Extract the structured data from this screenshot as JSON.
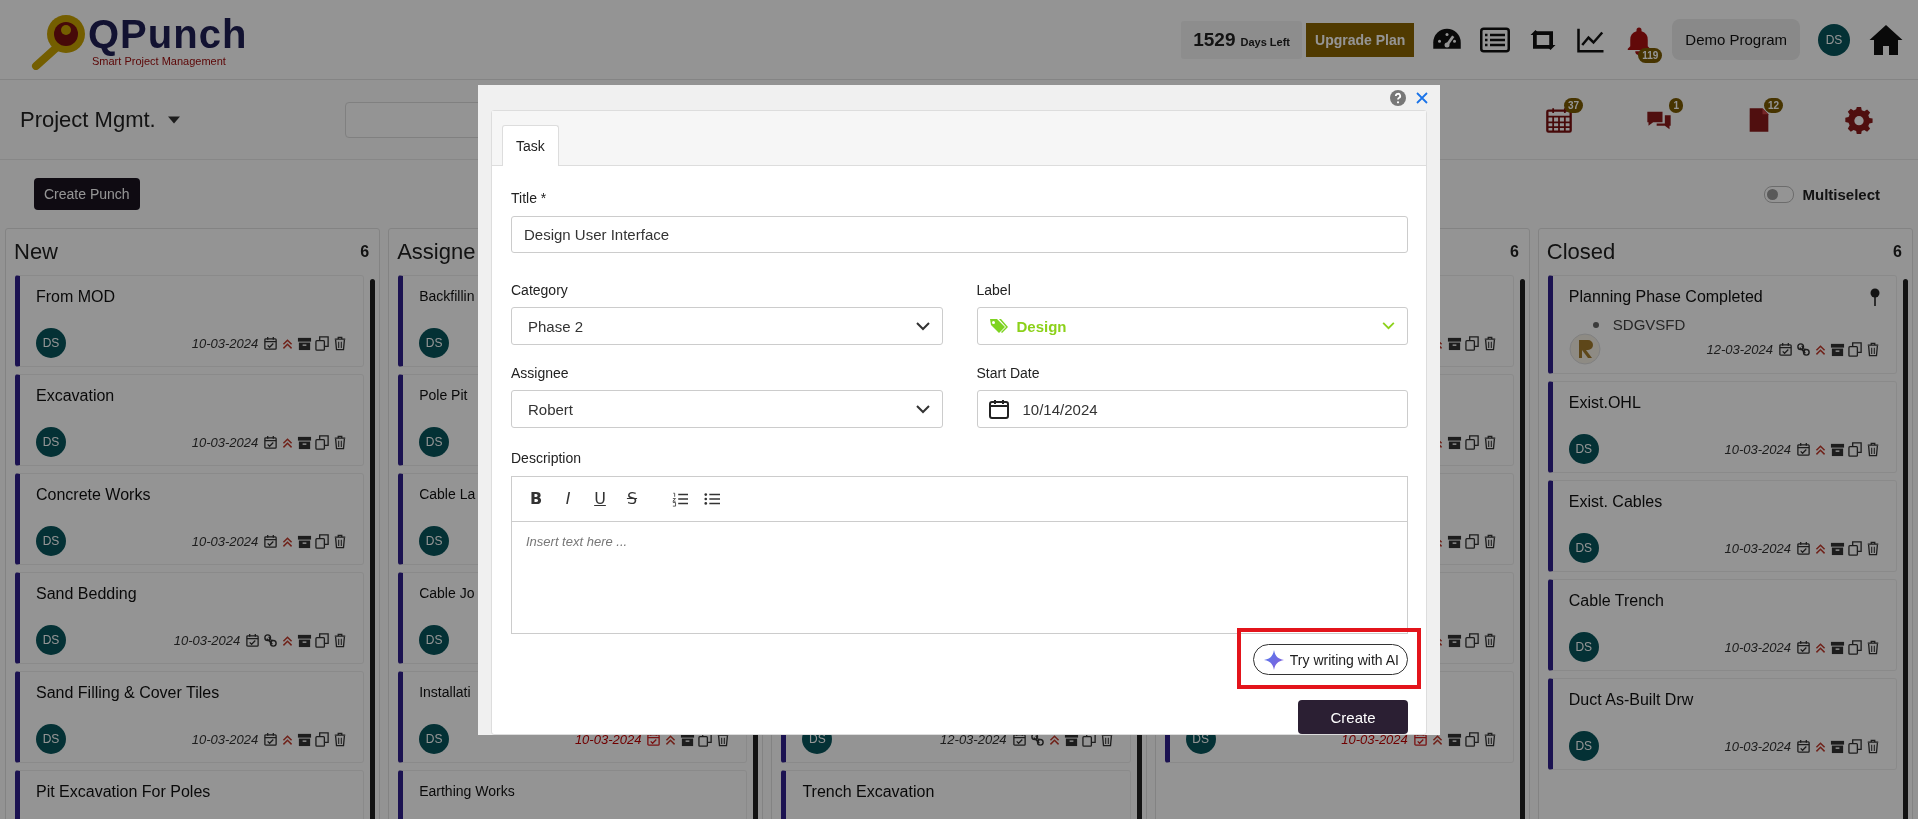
{
  "header": {
    "logo": {
      "name": "QPunch",
      "tagline": "Smart Project Management"
    },
    "days_left": {
      "count": "1529",
      "label": "Days Left"
    },
    "upgrade_button": "Upgrade Plan",
    "toolbar_icons": [
      {
        "kind": "dashboard"
      },
      {
        "kind": "list"
      },
      {
        "kind": "sync"
      },
      {
        "kind": "chart"
      },
      {
        "kind": "bell",
        "badge": "119"
      }
    ],
    "program": "Demo Program",
    "user_avatar": "DS"
  },
  "subbar": {
    "title": "Project Mgmt.",
    "icons": [
      {
        "kind": "calendar",
        "badge": "37"
      },
      {
        "kind": "chat",
        "badge": "1"
      },
      {
        "kind": "document",
        "badge": "12"
      },
      {
        "kind": "gear"
      }
    ]
  },
  "actions": {
    "create_button": "Create Punch",
    "multiselect": {
      "label": "Multiselect",
      "on": false
    }
  },
  "columns": [
    {
      "title": "New",
      "count": "6",
      "cards": [
        {
          "title": "From MOD",
          "avatar": {
            "kind": "initials",
            "text": "DS"
          },
          "date": "10-03-2024",
          "overdue": false,
          "linked": false,
          "actions": true
        },
        {
          "title": "Excavation",
          "avatar": {
            "kind": "initials",
            "text": "DS"
          },
          "date": "10-03-2024",
          "overdue": false,
          "linked": false,
          "actions": true
        },
        {
          "title": "Concrete Works",
          "avatar": {
            "kind": "initials",
            "text": "DS"
          },
          "date": "10-03-2024",
          "overdue": false,
          "linked": false,
          "actions": true
        },
        {
          "title": "Sand Bedding",
          "avatar": {
            "kind": "initials",
            "text": "DS"
          },
          "date": "10-03-2024",
          "overdue": false,
          "linked": true,
          "actions": true
        },
        {
          "title": "Sand Filling & Cover Tiles",
          "avatar": {
            "kind": "initials",
            "text": "DS"
          },
          "date": "10-03-2024",
          "overdue": false,
          "linked": false,
          "actions": true
        },
        {
          "title": "Pit Excavation For Poles"
        }
      ]
    },
    {
      "title": "Assigne",
      "cards": [
        {
          "title": "Backfillin",
          "avatar": {
            "kind": "initials",
            "text": "DS"
          }
        },
        {
          "title": "Pole Pit",
          "avatar": {
            "kind": "initials",
            "text": "DS"
          }
        },
        {
          "title": "Cable La",
          "avatar": {
            "kind": "initials",
            "text": "DS"
          }
        },
        {
          "title": "Cable Jo",
          "avatar": {
            "kind": "initials",
            "text": "DS"
          }
        },
        {
          "title": "Installati",
          "avatar": {
            "kind": "initials",
            "text": "DS"
          },
          "date": "10-03-2024",
          "overdue": true,
          "linked": false,
          "actions": true
        },
        {
          "title": "Earthing Works"
        }
      ]
    },
    {
      "cards": [
        {
          "avatar": {
            "kind": "initials",
            "text": "DS"
          },
          "date": "12-03-2024",
          "overdue": false,
          "linked": true,
          "actions": true
        },
        {
          "title": "Trench Excavation"
        }
      ]
    },
    {
      "count": "6",
      "cards": [
        {
          "actions": true
        },
        {
          "actions": true
        },
        {
          "actions": true
        },
        {
          "actions": true
        },
        {
          "avatar": {
            "kind": "initials",
            "text": "DS"
          },
          "date": "10-03-2024",
          "overdue": true,
          "linked": false,
          "actions": true
        }
      ]
    },
    {
      "title": "Closed",
      "count": "6",
      "cards": [
        {
          "title": "Planning Phase Completed",
          "pinned": true,
          "bullets": [
            "SDGVSFD"
          ],
          "avatar": {
            "kind": "logo"
          },
          "date": "12-03-2024",
          "overdue": false,
          "linked": true,
          "actions": true
        },
        {
          "title": "Exist.OHL",
          "avatar": {
            "kind": "initials",
            "text": "DS"
          },
          "date": "10-03-2024",
          "overdue": false,
          "linked": false,
          "actions": true
        },
        {
          "title": "Exist. Cables",
          "avatar": {
            "kind": "initials",
            "text": "DS"
          },
          "date": "10-03-2024",
          "overdue": false,
          "linked": false,
          "actions": true
        },
        {
          "title": "Cable Trench",
          "avatar": {
            "kind": "initials",
            "text": "DS"
          },
          "date": "10-03-2024",
          "overdue": false,
          "linked": false,
          "actions": true
        },
        {
          "title": "Duct As-Built Drw",
          "avatar": {
            "kind": "initials",
            "text": "DS"
          },
          "date": "10-03-2024",
          "overdue": false,
          "linked": false,
          "actions": true
        }
      ]
    }
  ],
  "modal": {
    "tabs": [
      {
        "label": "Task",
        "selected": true
      }
    ],
    "title_field": {
      "label": "Title *",
      "value": "Design User Interface"
    },
    "fields": [
      {
        "kind": "select",
        "label": "Category",
        "value": "Phase 2"
      },
      {
        "kind": "tag-select",
        "label": "Label",
        "value": "Design"
      },
      {
        "kind": "select",
        "label": "Assignee",
        "value": "Robert"
      },
      {
        "kind": "date",
        "label": "Start Date",
        "value": "10/14/2024"
      }
    ],
    "description": {
      "label": "Description",
      "placeholder": "Insert text here ...",
      "tools": [
        {
          "kind": "bold",
          "glyph": "B"
        },
        {
          "kind": "italic",
          "glyph": "I"
        },
        {
          "kind": "underline",
          "glyph": "U"
        },
        {
          "kind": "strike",
          "glyph": "S"
        },
        {
          "kind": "ordered-list"
        },
        {
          "kind": "bullet-list"
        }
      ]
    },
    "ai_button": {
      "label": "Try writing with AI",
      "highlighted": true
    },
    "submit_button": "Create"
  }
}
